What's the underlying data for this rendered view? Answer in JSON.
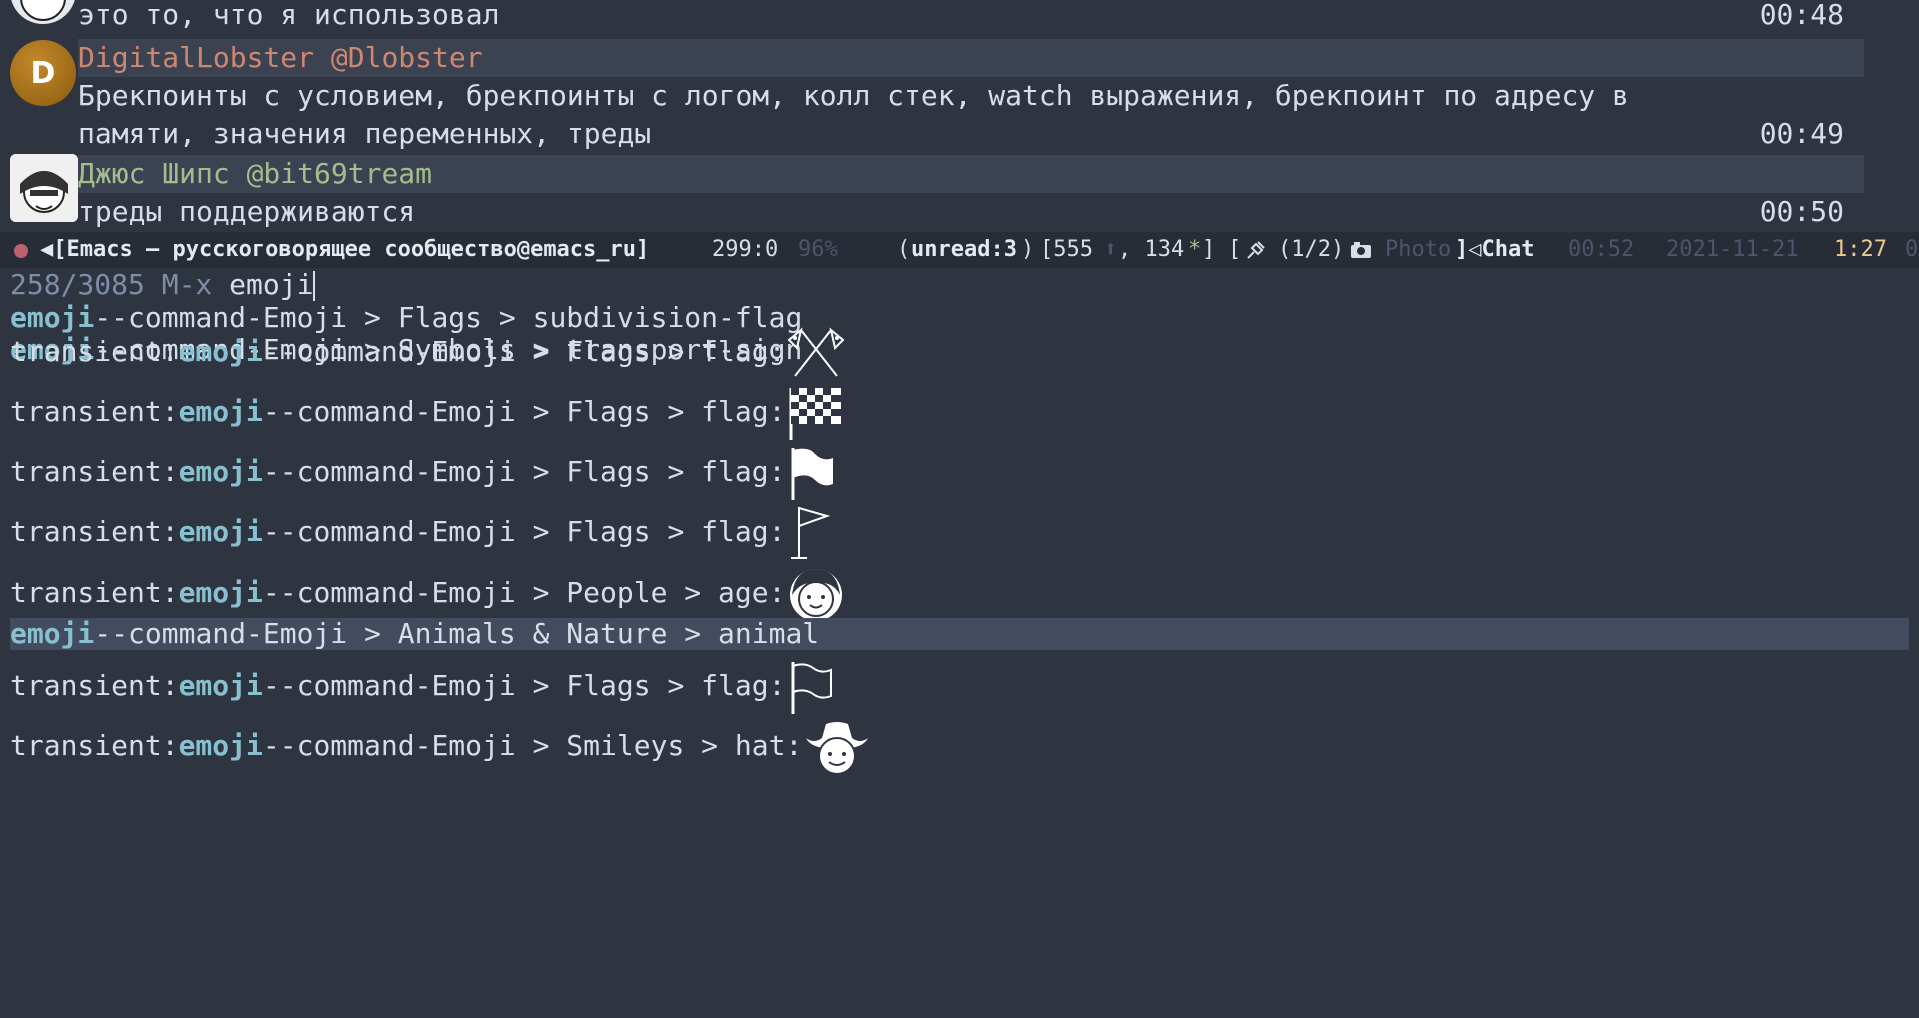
{
  "chat": {
    "messages": [
      {
        "text": "это то, что я использовал",
        "time": "00:48"
      },
      {
        "sender": "DigitalLobster",
        "handle": "@Dlobster",
        "avatar_letter": "D",
        "line1": "Брекпоинты с условием, брекпоинты с логом, колл стек, watch выражения, брекпоинт по адресу в",
        "line2": "памяти, значения переменных, треды",
        "time": "00:49"
      },
      {
        "sender": "Джюс Шипс",
        "handle": "@bit69tream",
        "text": "треды поддерживаются",
        "time": "00:50"
      }
    ]
  },
  "modeline": {
    "buffer": "◀[Emacs — русскоговорящее сообщество@emacs_ru]",
    "position": "299:0",
    "percent": "96%",
    "unread_open": "(",
    "unread": "unread:3",
    "unread_close": ")",
    "counts": "[555",
    "counts_sep": ", 134",
    "star": "*",
    "bracket_close": "]",
    "pinned_open": "[",
    "pinned": "(1/2)",
    "photo": "Photo",
    "chat_label": "]◁Chat",
    "time_dim": "00:52",
    "date": "2021-11-21",
    "clock": "1:27",
    "tail": "0"
  },
  "minibuffer": {
    "count": "258/3085",
    "prompt": "M-x",
    "input": "emoji"
  },
  "candidates": [
    {
      "match": "emoji",
      "rest": "--command-Emoji > Flags > subdivision-flag"
    },
    {
      "match": "emoji",
      "rest": "--command-Emoji > Symbols > transport-sign"
    },
    {
      "prefix": "transient:",
      "match": "emoji",
      "rest": "--command-Emoji > Flags > flag:",
      "emoji": "crossed-flags-icon"
    },
    {
      "prefix": "transient:",
      "match": "emoji",
      "rest": "--command-Emoji > Flags > flag:",
      "emoji": "checkered-flag-icon"
    },
    {
      "prefix": "transient:",
      "match": "emoji",
      "rest": "--command-Emoji > Flags > flag:",
      "emoji": "waving-flag-icon"
    },
    {
      "prefix": "transient:",
      "match": "emoji",
      "rest": "--command-Emoji > Flags > flag:",
      "emoji": "triangular-flag-icon"
    },
    {
      "prefix": "transient:",
      "match": "emoji",
      "rest": "--command-Emoji > People > age:",
      "emoji": "child-face-icon"
    },
    {
      "match": "emoji",
      "rest": "--command-Emoji > Animals & Nature > animal",
      "selected": true
    },
    {
      "prefix": "transient:",
      "match": "emoji",
      "rest": "--command-Emoji > Flags > flag:",
      "emoji": "white-flag-icon"
    },
    {
      "prefix": "transient:",
      "match": "emoji",
      "rest": "--command-Emoji > Smileys > hat:",
      "emoji": "cowboy-face-icon"
    }
  ],
  "colors": {
    "background": "#2e3440",
    "match": "#88c0d0",
    "selection": "#434c5e",
    "sender1": "#d08770",
    "sender2": "#a3be8c"
  }
}
